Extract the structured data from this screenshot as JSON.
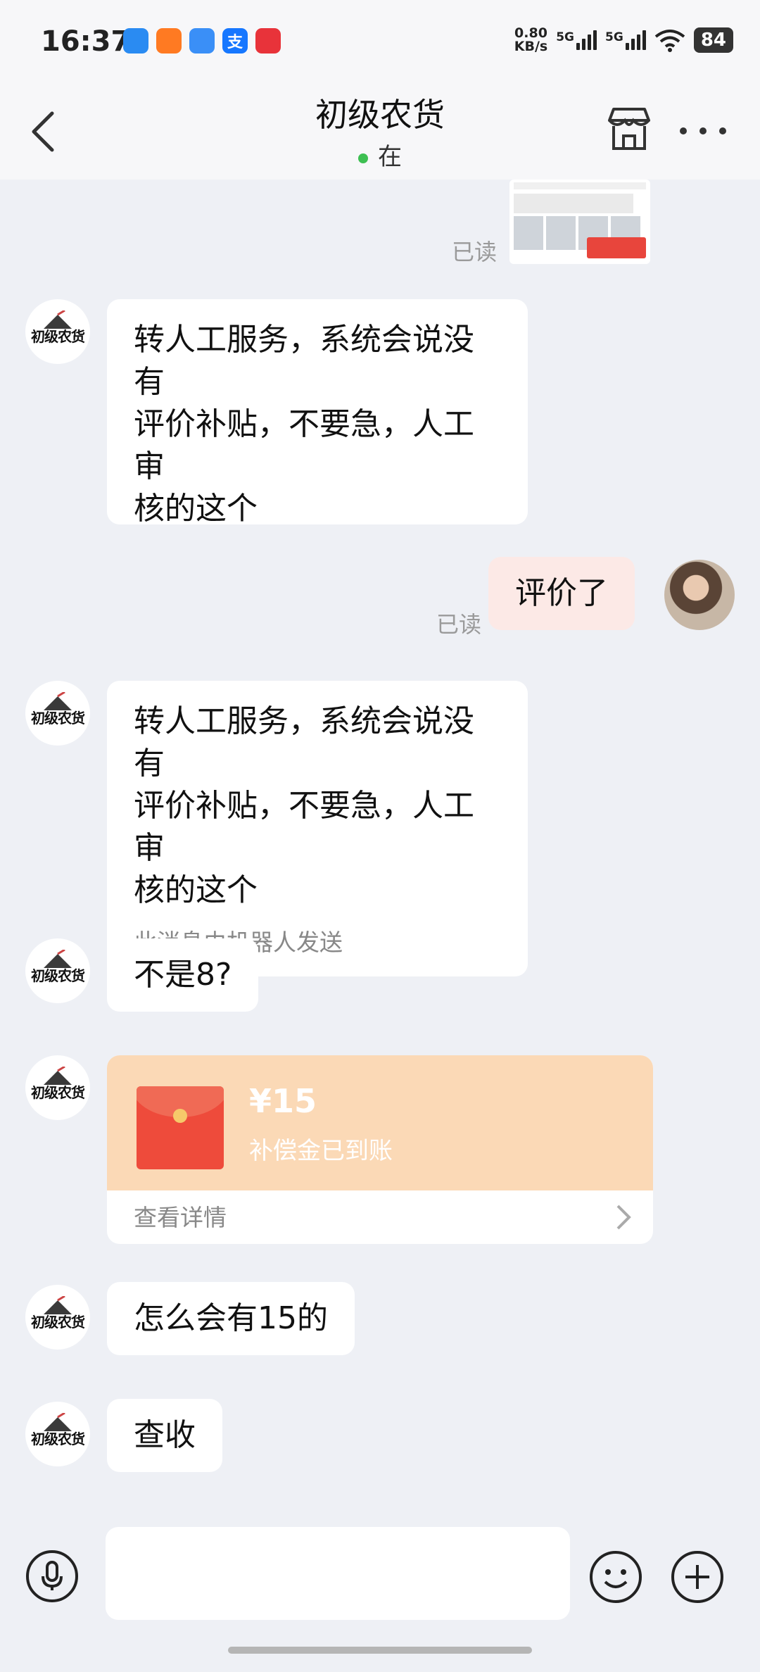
{
  "status_bar": {
    "time": "16:37",
    "apps": [
      {
        "name": "app-icon-1",
        "glyph": "",
        "color": "#2a8bf2"
      },
      {
        "name": "app-icon-2",
        "glyph": "",
        "color": "#ff7a22"
      },
      {
        "name": "app-icon-3",
        "glyph": "",
        "color": "#3a8ff7"
      },
      {
        "name": "alipay-icon",
        "glyph": "支",
        "color": "#1677ff"
      },
      {
        "name": "music-icon",
        "glyph": "",
        "color": "#e8333a"
      }
    ],
    "net_speed_value": "0.80",
    "net_speed_unit": "KB/s",
    "sim1": "5G",
    "sim2": "5G",
    "battery": "84"
  },
  "header": {
    "title": "初级农货",
    "presence": "在"
  },
  "avatar_label": "初级农货",
  "messages": {
    "read_label": "已读",
    "m1": {
      "line1": "转人工服务，系统会说没有",
      "line2": "评价补贴，不要急，人工审",
      "line3": "核的这个"
    },
    "m2": {
      "text": "评价了"
    },
    "m3": {
      "line1": "转人工服务，系统会说没有",
      "line2": "评价补贴，不要急，人工审",
      "line3": "核的这个",
      "note": "此消息由机器人发送"
    },
    "m4": {
      "text": "不是8?"
    },
    "m5": {
      "amount": "¥15",
      "desc": "补偿金已到账",
      "link": "查看详情"
    },
    "m6": {
      "text": "怎么会有15的"
    },
    "m7": {
      "text": "查收"
    }
  }
}
